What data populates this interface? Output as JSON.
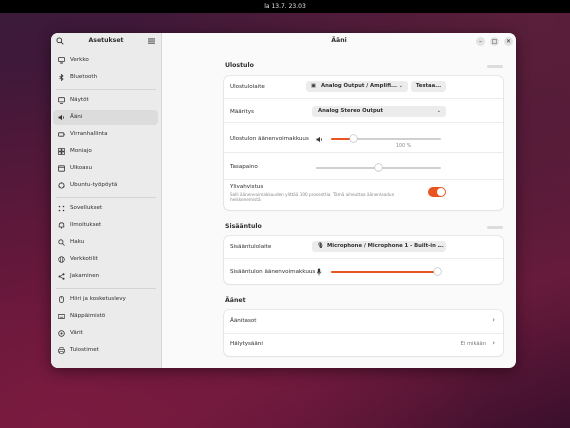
{
  "topbar": {
    "clock": "la 13.7.  23.03"
  },
  "sidebar": {
    "title": "Asetukset",
    "items": [
      {
        "label": "Verkko",
        "icon": "network-icon"
      },
      {
        "label": "Bluetooth",
        "icon": "bluetooth-icon"
      },
      {
        "label": "Näytöt",
        "icon": "display-icon"
      },
      {
        "label": "Ääni",
        "icon": "speaker-icon",
        "active": true
      },
      {
        "label": "Virranhallinta",
        "icon": "power-icon"
      },
      {
        "label": "Moniajo",
        "icon": "multitasking-icon"
      },
      {
        "label": "Ulkoasu",
        "icon": "appearance-icon"
      },
      {
        "label": "Ubuntu-työpöytä",
        "icon": "ubuntu-desktop-icon"
      },
      {
        "label": "Sovellukset",
        "icon": "apps-icon"
      },
      {
        "label": "Ilmoitukset",
        "icon": "notifications-icon"
      },
      {
        "label": "Haku",
        "icon": "search-icon"
      },
      {
        "label": "Verkkotilit",
        "icon": "online-accounts-icon"
      },
      {
        "label": "Jakaminen",
        "icon": "sharing-icon"
      },
      {
        "label": "Hiiri ja kosketuslevy",
        "icon": "mouse-icon"
      },
      {
        "label": "Näppäimistö",
        "icon": "keyboard-icon"
      },
      {
        "label": "Värit",
        "icon": "color-icon"
      },
      {
        "label": "Tulostimet",
        "icon": "printer-icon"
      }
    ]
  },
  "content": {
    "title": "Ääni",
    "output": {
      "section_title": "Ulostulo",
      "device_label": "Ulostulolaite",
      "device_value": "Analog Output / Amplifi...",
      "test_button": "Testaa...",
      "config_label": "Määritys",
      "config_value": "Analog Stereo Output",
      "volume_label": "Ulostulon äänenvoimakkuus",
      "volume_percent": "100 %",
      "volume_level": 0.18,
      "balance_label": "Tasapaino",
      "balance_level": 0.5,
      "overamp_label": "Ylivahvistus",
      "overamp_desc": "Salli äänenvoimakkuuden ylittää 100 prosenttia. Tämä aiheuttaa äänenlaadun heikkenemistä.",
      "overamp_on": true
    },
    "input": {
      "section_title": "Sisääntulo",
      "device_label": "Sisääntulolaite",
      "device_value": "Microphone / Microphone 1 - Built-in ...",
      "volume_label": "Sisääntulon äänenvoimakkuus",
      "volume_level": 1.0
    },
    "sounds": {
      "section_title": "Äänet",
      "alert_levels_label": "Äänitasot",
      "alert_sound_label": "Hälytysääni",
      "alert_sound_value": "Ei mikään"
    }
  },
  "colors": {
    "accent": "#e95420"
  }
}
